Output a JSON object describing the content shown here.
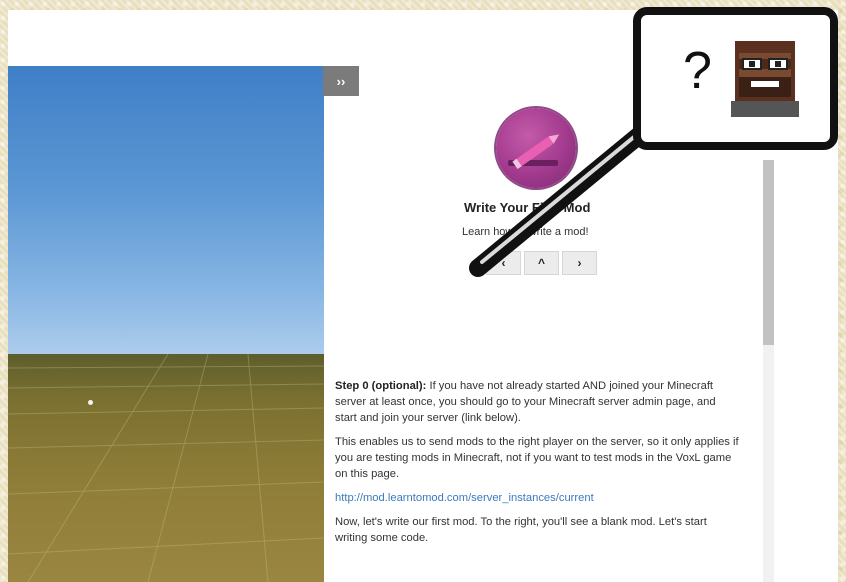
{
  "panel": {
    "toggle_label": "››",
    "tutorial_title": "Write Your First Mod",
    "tutorial_subtitle": "Learn how to write a mod!",
    "nav": {
      "prev": "‹",
      "up": "^",
      "next": "›"
    }
  },
  "content": {
    "step_label": "Step 0 (optional):",
    "step_text": " If you have not already started AND joined your Minecraft server at least once, you should go to your Minecraft server admin page, and start and join your server (link below).",
    "para2": "This enables us to send mods to the right player on the server, so it only applies if you are testing mods in Minecraft, not if you want to test mods in the VoxL game on this page.",
    "link": "http://mod.learntomod.com/server_instances/current",
    "para3": "Now, let's write our first mod. To the right, you'll see a blank mod. Let's start writing some code."
  },
  "callout": {
    "symbol": "?"
  },
  "icons": {
    "avatar": "pencil-icon",
    "helper": "help-character-icon",
    "lens": "magnifier-icon"
  },
  "colors": {
    "avatar": "#a23a8e",
    "link": "#3a7abf",
    "toggle": "#7b7b7b"
  }
}
